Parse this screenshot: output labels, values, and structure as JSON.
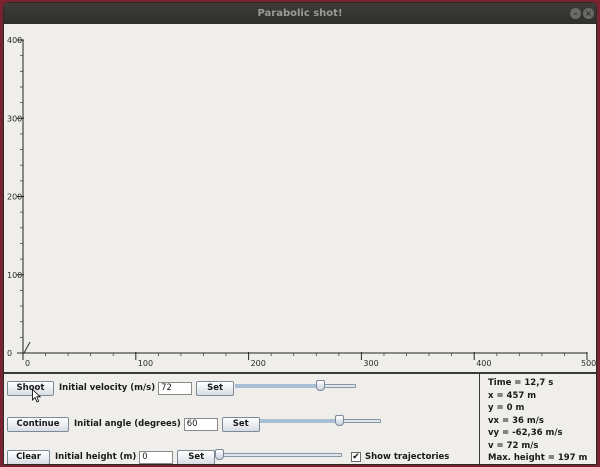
{
  "window": {
    "title": "Parabolic shot!",
    "minimize_glyph": "–",
    "close_glyph": "×"
  },
  "plot": {
    "y_ticks": [
      "400",
      "300",
      "200",
      "100",
      "0"
    ],
    "x_ticks": [
      "0",
      "100",
      "200",
      "300",
      "400",
      "500"
    ]
  },
  "controls": {
    "row1": {
      "button": "Shoot",
      "label": "Initial velocity (m/s)",
      "value": "72",
      "set": "Set",
      "slider_fraction": 0.72
    },
    "row2": {
      "button": "Continue",
      "label": "Initial angle (degrees)",
      "value": "60",
      "set": "Set",
      "slider_fraction": 0.67
    },
    "row3": {
      "button": "Clear",
      "label": "Initial height (m)",
      "value": "0",
      "set": "Set",
      "slider_fraction": 0.0
    },
    "show_trajectories": {
      "label": "Show trajectories",
      "checked": true,
      "check_glyph": "✔"
    }
  },
  "info": {
    "time": "Time = 12,7 s",
    "x": "x = 457 m",
    "y": "y = 0 m",
    "vx": "vx = 36 m/s",
    "vy": "vy = -62,36 m/s",
    "v": "v = 72 m/s",
    "max_height": "Max. height = 197 m"
  },
  "colors": {
    "background": "#7a2232",
    "titlebar": "#2f2e2b",
    "panel": "#efeeea"
  }
}
